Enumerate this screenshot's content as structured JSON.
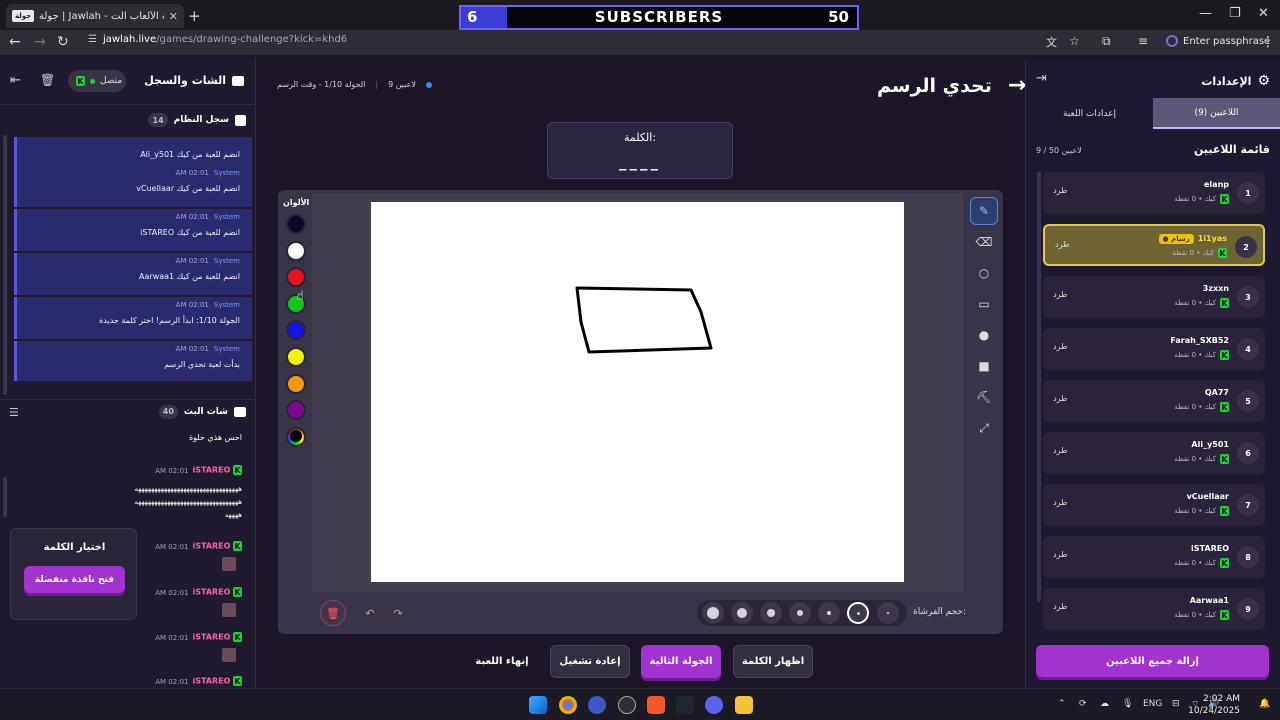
{
  "browser": {
    "tab_title": "جولة | Jawlah - منصة الألعاب الت...",
    "tab_icon_text": "جولة",
    "url_site": "jawlah.live",
    "url_path": "/games/drawing-challenge?kick=khd6",
    "passphrase": "Enter passphrase"
  },
  "banner": {
    "left": "6",
    "label": "SUBSCRIBERS",
    "right": "50"
  },
  "left_panel": {
    "title": "الشات والسجل",
    "status": "متصل",
    "system_log": {
      "title": "سجل النظام",
      "count": "14",
      "entries": [
        {
          "msg": "Ali_y501 انضم للعبة من كيك",
          "sys": "",
          "time": ""
        },
        {
          "msg": "vCuellaar انضم للعبة من كيك",
          "sys": "System",
          "time": "AM 02:01"
        },
        {
          "msg": "iSTAREO انضم للعبة من كيك",
          "sys": "System",
          "time": "AM 02:01"
        },
        {
          "msg": "Aarwaa1 انضم للعبة من كيك",
          "sys": "System",
          "time": "AM 02:01"
        },
        {
          "msg": "الجولة 1/10: ابدأ الرسم! اختر كلمة جديدة",
          "sys": "System",
          "time": "AM 02:01"
        },
        {
          "msg": "بدأت لعبة تحدي الرسم",
          "sys": "System",
          "time": "AM 02:01"
        }
      ]
    },
    "bot_chat": {
      "title": "شات البث",
      "count": "40",
      "messages": [
        {
          "time": "",
          "user": "",
          "text": "احس هذي حلوة"
        },
        {
          "time": "AM 02:01",
          "user": "iSTAREO",
          "text": "ههههههههههههههههههههههههههههههههههههههههههههههههههههههههههههههههه"
        },
        {
          "time": "AM 02:01",
          "user": "iSTAREO",
          "text": ""
        },
        {
          "time": "AM 02:01",
          "user": "iSTAREO",
          "text": ""
        },
        {
          "time": "AM 02:01",
          "user": "iSTAREO",
          "text": ""
        },
        {
          "time": "AM 02:01",
          "user": "iSTAREO",
          "text": ""
        }
      ],
      "laugh_line1": "ههههههههههههههههههههههههههههههههه",
      "laugh_line2": "ههههههههههههههههههههههههههههههههه",
      "laugh_line3": "ههههه"
    },
    "word_box": {
      "title": "اختيار الكلمة",
      "button": "فتح نافذة منفصلة"
    }
  },
  "center": {
    "game_title": "تحدي الرسم",
    "round_info": "الجولة 1/10 - وقت الرسم",
    "players_info": "9 لاعبين",
    "word_label": "الكلمة:",
    "word_blank": "____",
    "colors_label": "الألوان",
    "colors": [
      "#0b0b2e",
      "#ffffff",
      "#e5141f",
      "#16c21e",
      "#1414e0",
      "#f5f500",
      "#f59a0c",
      "#7a0a91",
      "#000000"
    ],
    "brush_label": "حجم الفرشاة:",
    "buttons": {
      "end_game": "إنهاء اللعبة",
      "restart": "إعادة تشغيل",
      "next_round": "الجولة التالية",
      "show_word": "اظهار الكلمة"
    }
  },
  "right_panel": {
    "title": "الإعدادات",
    "tab_players": "اللاعبين (9)",
    "tab_settings": "إعدادات اللعبة",
    "list_title": "قائمة اللاعبين",
    "list_count": "9 / 50 لاعبين",
    "players": [
      {
        "num": "1",
        "name": "elanp",
        "info": "كيك • 0 نقطة",
        "kick": "طرد",
        "badge": ""
      },
      {
        "num": "2",
        "name": "1i1yas",
        "info": "كيك • 0 نقطة",
        "kick": "طرد",
        "badge": "رسام"
      },
      {
        "num": "3",
        "name": "3zxxn",
        "info": "كيك • 0 نقطة",
        "kick": "طرد",
        "badge": ""
      },
      {
        "num": "4",
        "name": "Farah_SXB52",
        "info": "كيك • 0 نقطة",
        "kick": "طرد",
        "badge": ""
      },
      {
        "num": "5",
        "name": "QA77",
        "info": "كيك • 0 نقطة",
        "kick": "طرد",
        "badge": ""
      },
      {
        "num": "6",
        "name": "Ali_y501",
        "info": "كيك • 0 نقطة",
        "kick": "طرد",
        "badge": ""
      },
      {
        "num": "7",
        "name": "vCuellaar",
        "info": "كيك • 0 نقطة",
        "kick": "طرد",
        "badge": ""
      },
      {
        "num": "8",
        "name": "iSTAREO",
        "info": "كيك • 0 نقطة",
        "kick": "طرد",
        "badge": ""
      },
      {
        "num": "9",
        "name": "Aarwaa1",
        "info": "كيك • 0 نقطة",
        "kick": "طرد",
        "badge": ""
      }
    ],
    "kick_all": "إزالة جميع اللاعبين"
  },
  "taskbar": {
    "lang": "ENG",
    "time": "2:02 AM",
    "date": "10/24/2025"
  }
}
